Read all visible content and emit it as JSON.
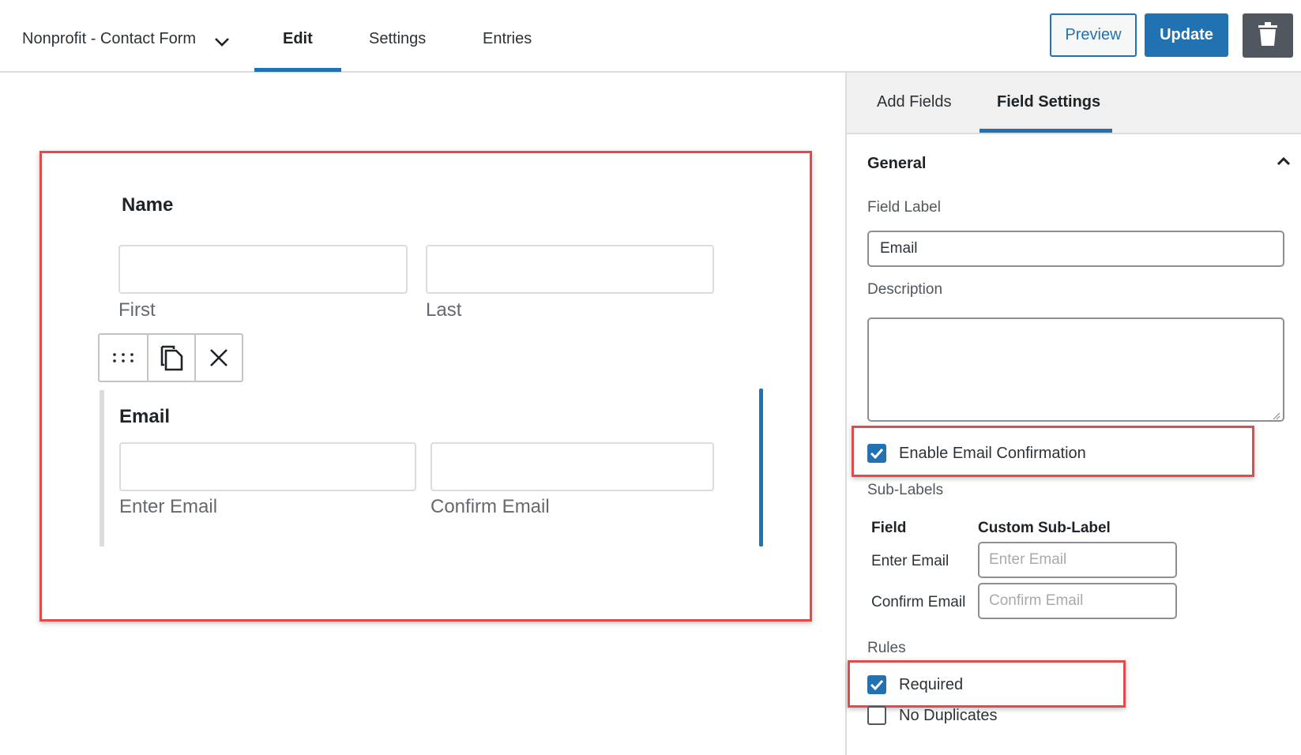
{
  "header": {
    "form_title": "Nonprofit - Contact Form",
    "tabs": [
      {
        "label": "Edit",
        "active": true
      },
      {
        "label": "Settings",
        "active": false
      },
      {
        "label": "Entries",
        "active": false
      }
    ],
    "preview_label": "Preview",
    "update_label": "Update",
    "accent_color": "#2271b1"
  },
  "canvas": {
    "fields": [
      {
        "title": "Name",
        "sub_labels": [
          "First",
          "Last"
        ]
      },
      {
        "title": "Email",
        "sub_labels": [
          "Enter Email",
          "Confirm Email"
        ]
      }
    ],
    "toolbar_icons": [
      "drag-handle-icon",
      "duplicate-icon",
      "close-icon"
    ]
  },
  "sidebar": {
    "tabs": [
      {
        "label": "Add Fields",
        "active": false
      },
      {
        "label": "Field Settings",
        "active": true
      }
    ],
    "section": "General",
    "field_label_label": "Field Label",
    "field_label_value": "Email",
    "description_label": "Description",
    "enable_confirmation": {
      "label": "Enable Email Confirmation",
      "checked": true
    },
    "sub_labels": {
      "heading": "Sub-Labels",
      "col_field": "Field",
      "col_custom": "Custom Sub-Label",
      "rows": [
        {
          "field": "Enter Email",
          "placeholder": "Enter Email"
        },
        {
          "field": "Confirm Email",
          "placeholder": "Confirm Email"
        }
      ]
    },
    "rules": {
      "heading": "Rules",
      "required": {
        "label": "Required",
        "checked": true
      },
      "no_duplicates": {
        "label": "No Duplicates",
        "checked": false
      }
    }
  },
  "highlight_color": "#e34b4b"
}
